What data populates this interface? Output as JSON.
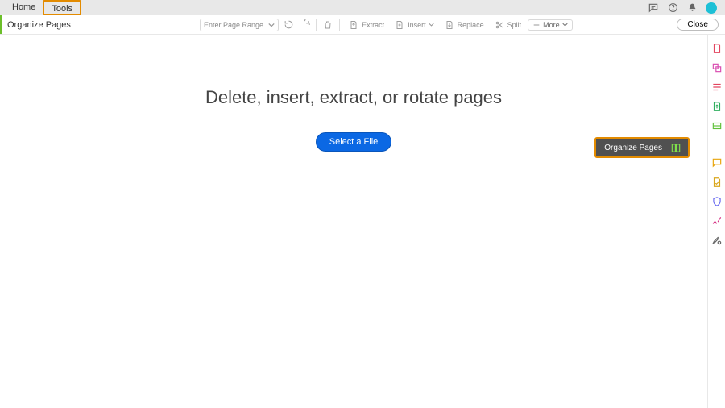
{
  "topbar": {
    "home_label": "Home",
    "tools_label": "Tools"
  },
  "toolrow": {
    "title": "Organize Pages",
    "page_range_placeholder": "Enter Page Range",
    "extract_label": "Extract",
    "insert_label": "Insert",
    "replace_label": "Replace",
    "split_label": "Split",
    "more_label": "More",
    "close_label": "Close"
  },
  "main": {
    "headline": "Delete, insert, extract, or rotate pages",
    "select_file_label": "Select a File"
  },
  "rail_tooltip": {
    "label": "Organize Pages"
  },
  "colors": {
    "highlight": "#e38b00",
    "accent_green": "#6cbf2a",
    "primary_button": "#0b68e4",
    "avatar": "#1dc0d6"
  }
}
